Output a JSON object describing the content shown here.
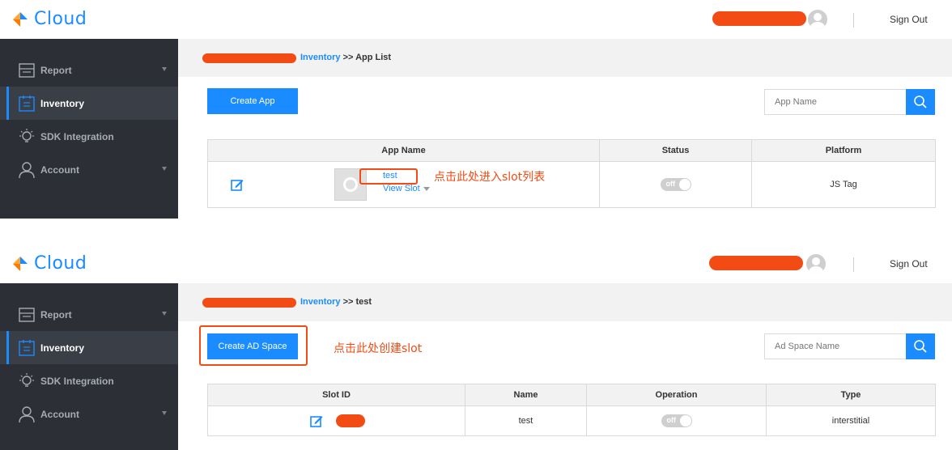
{
  "panel1": {
    "logo_text": "Cloud",
    "sign_out": "Sign Out",
    "sidebar": [
      {
        "label": "Report",
        "icon": "report-icon",
        "active": false,
        "caret": true
      },
      {
        "label": "Inventory",
        "icon": "inventory-icon",
        "active": true,
        "caret": false
      },
      {
        "label": "SDK Integration",
        "icon": "sdk-bulb-icon",
        "active": false,
        "caret": false
      },
      {
        "label": "Account",
        "icon": "account-icon",
        "active": false,
        "caret": true
      }
    ],
    "breadcrumb": {
      "link": "Inventory",
      "separator": ">>",
      "current": "App List"
    },
    "create_button": "Create App",
    "search_placeholder": "App Name",
    "table": {
      "headers": [
        "App Name",
        "Status",
        "Platform"
      ],
      "row": {
        "app_name": "test",
        "view_slot": "View Slot",
        "status": "off",
        "platform": "JS Tag"
      }
    },
    "annotation": "点击此处进入slot列表"
  },
  "panel2": {
    "logo_text": "Cloud",
    "sign_out": "Sign Out",
    "sidebar": [
      {
        "label": "Report",
        "icon": "report-icon",
        "active": false,
        "caret": true
      },
      {
        "label": "Inventory",
        "icon": "inventory-icon",
        "active": true,
        "caret": false
      },
      {
        "label": "SDK Integration",
        "icon": "sdk-bulb-icon",
        "active": false,
        "caret": false
      },
      {
        "label": "Account",
        "icon": "account-icon",
        "active": false,
        "caret": true
      }
    ],
    "breadcrumb": {
      "link": "Inventory",
      "separator": ">>",
      "current": "test"
    },
    "create_button": "Create AD Space",
    "search_placeholder": "Ad Space Name",
    "table": {
      "headers": [
        "Slot ID",
        "Name",
        "Operation",
        "Type"
      ],
      "row": {
        "name": "test",
        "operation": "off",
        "type": "interstitial"
      }
    },
    "annotation": "点击此处创建slot"
  },
  "colors": {
    "accent": "#1a8cff",
    "sidebar_bg": "#2c2f36",
    "sidebar_active": "#3a3e47",
    "annotation": "#f24b13"
  }
}
